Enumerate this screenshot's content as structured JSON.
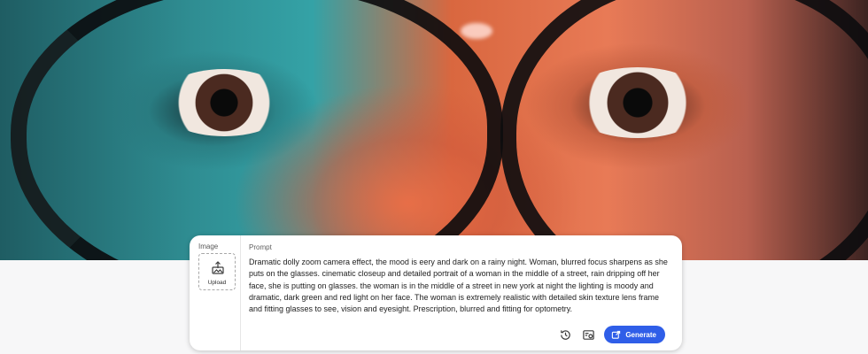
{
  "image_section": {
    "label": "Image",
    "upload_label": "Upload"
  },
  "prompt_section": {
    "label": "Prompt",
    "text": "Dramatic dolly zoom camera effect, the mood is eery and dark on a rainy night. Woman, blurred focus sharpens as she puts on the glasses. cinematic closeup and detailed portrait of a woman in the middle of a street, rain dripping off her face, she is putting on glasses. the woman is in the middle of a street in new york at night the lighting is moody and dramatic, dark green and red light on her face. The woman is extremely realistic with detailed skin texture lens frame and fitting glasses to see, vision and eyesight. Prescription, blurred and fitting for optometry."
  },
  "actions": {
    "history_icon": "history-icon",
    "settings_icon": "image-settings-icon",
    "generate_label": "Generate"
  },
  "colors": {
    "accent": "#2f5ee8",
    "panel_background": "#ffffff",
    "text": "#222222"
  }
}
